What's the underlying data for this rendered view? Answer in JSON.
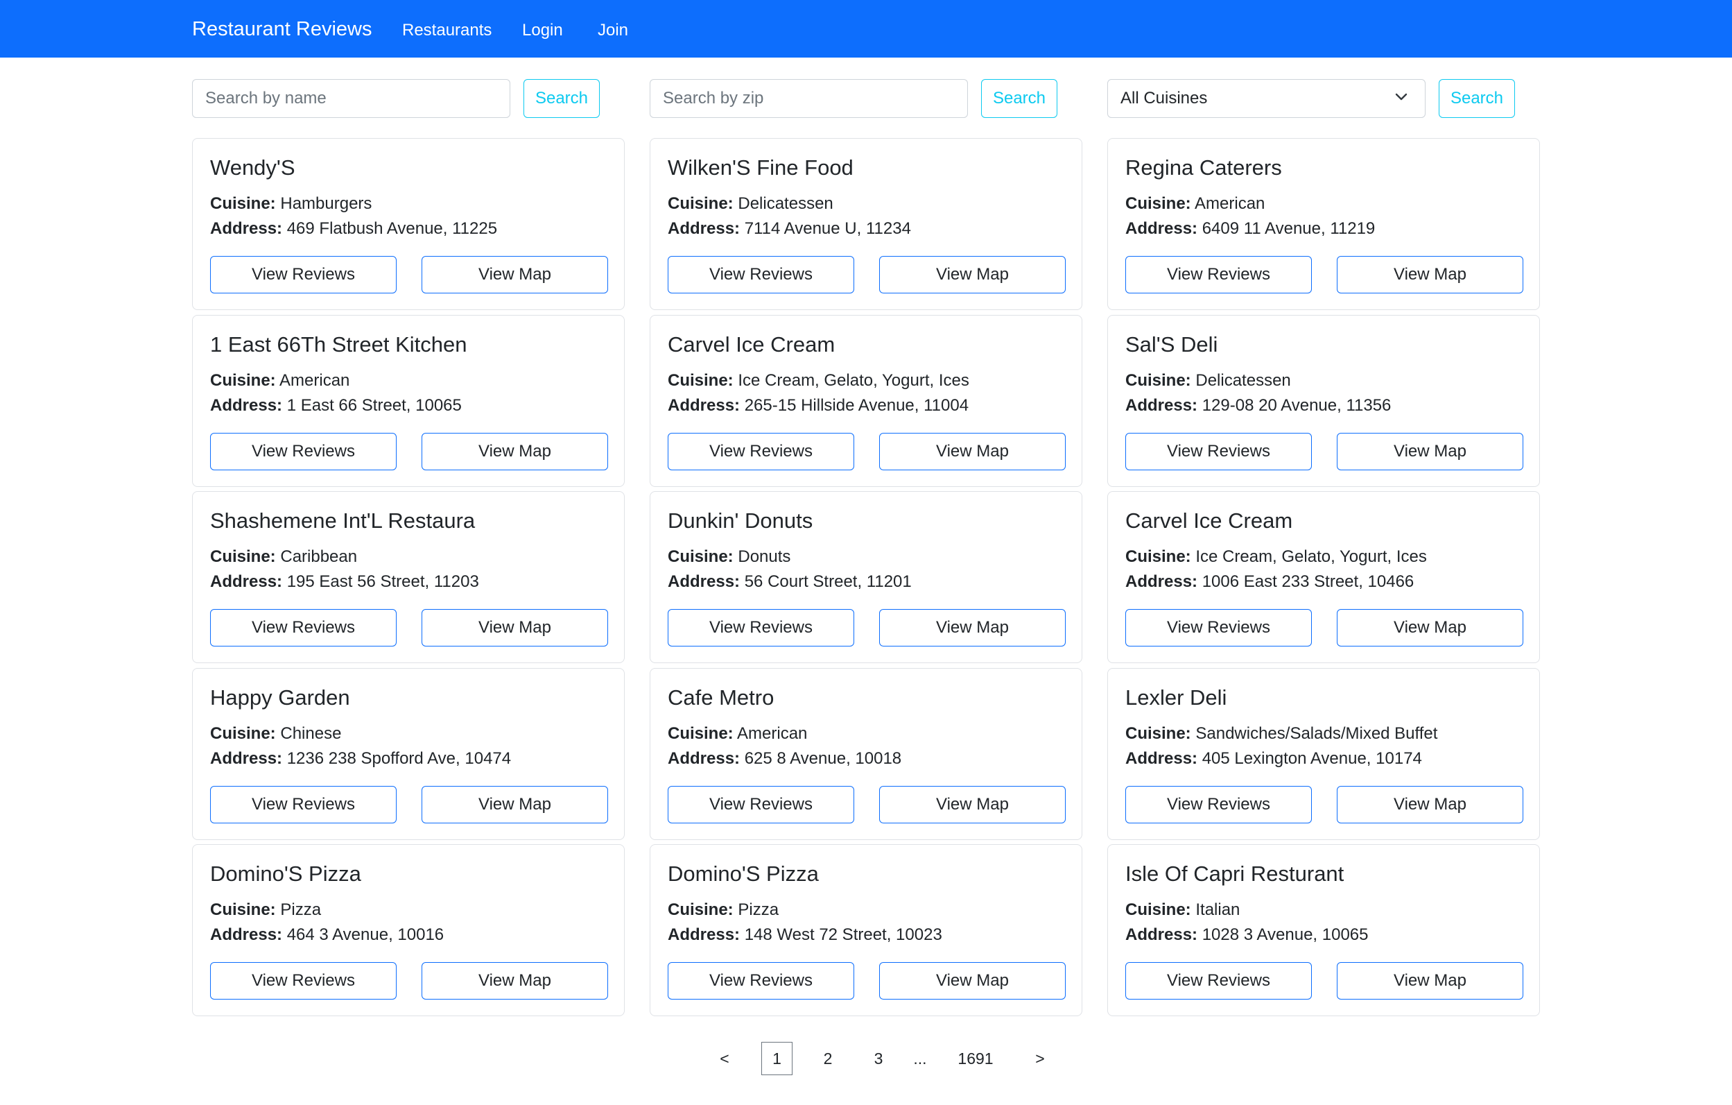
{
  "navbar": {
    "brand": "Restaurant Reviews",
    "links": [
      "Restaurants",
      "Login",
      "Join"
    ]
  },
  "search": {
    "name_placeholder": "Search by name",
    "zip_placeholder": "Search by zip",
    "cuisine_selected": "All Cuisines",
    "button_label": "Search"
  },
  "labels": {
    "cuisine": "Cuisine:",
    "address": "Address:",
    "view_reviews": "View Reviews",
    "view_map": "View Map"
  },
  "restaurants": [
    {
      "name": "Wendy'S",
      "cuisine": "Hamburgers",
      "address": "469 Flatbush Avenue, 11225"
    },
    {
      "name": "Wilken'S Fine Food",
      "cuisine": "Delicatessen",
      "address": "7114 Avenue U, 11234"
    },
    {
      "name": "Regina Caterers",
      "cuisine": "American",
      "address": "6409 11 Avenue, 11219"
    },
    {
      "name": "1 East 66Th Street Kitchen",
      "cuisine": "American",
      "address": "1 East 66 Street, 10065"
    },
    {
      "name": "Carvel Ice Cream",
      "cuisine": "Ice Cream, Gelato, Yogurt, Ices",
      "address": "265-15 Hillside Avenue, 11004"
    },
    {
      "name": "Sal'S Deli",
      "cuisine": "Delicatessen",
      "address": "129-08 20 Avenue, 11356"
    },
    {
      "name": "Shashemene Int'L Restaura",
      "cuisine": "Caribbean",
      "address": "195 East 56 Street, 11203"
    },
    {
      "name": "Dunkin' Donuts",
      "cuisine": "Donuts",
      "address": "56 Court Street, 11201"
    },
    {
      "name": "Carvel Ice Cream",
      "cuisine": "Ice Cream, Gelato, Yogurt, Ices",
      "address": "1006 East 233 Street, 10466"
    },
    {
      "name": "Happy Garden",
      "cuisine": "Chinese",
      "address": "1236 238 Spofford Ave, 10474"
    },
    {
      "name": "Cafe Metro",
      "cuisine": "American",
      "address": "625 8 Avenue, 10018"
    },
    {
      "name": "Lexler Deli",
      "cuisine": "Sandwiches/Salads/Mixed Buffet",
      "address": "405 Lexington Avenue, 10174"
    },
    {
      "name": "Domino'S Pizza",
      "cuisine": "Pizza",
      "address": "464 3 Avenue, 10016"
    },
    {
      "name": "Domino'S Pizza",
      "cuisine": "Pizza",
      "address": "148 West 72 Street, 10023"
    },
    {
      "name": "Isle Of Capri Resturant",
      "cuisine": "Italian",
      "address": "1028 3 Avenue, 10065"
    }
  ],
  "pagination": {
    "prev": "<",
    "pages": [
      "1",
      "2",
      "3"
    ],
    "ellipsis": "...",
    "last": "1691",
    "next": ">",
    "active": "1"
  },
  "colors": {
    "navbar": "#0d6efd",
    "search_button": "#0dcaf0",
    "card_button_border": "#0d6efd"
  }
}
